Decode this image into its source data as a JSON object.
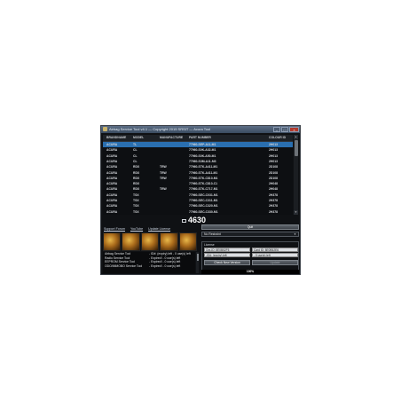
{
  "window": {
    "title": "Airbag Service Tool v4.1 — Copyright 2015 SRSIT — Acura Tool"
  },
  "table": {
    "columns": [
      "BRANDNAME",
      "MODEL",
      "MANUFACTURE",
      "PART NUMBER",
      "COLOUR ID"
    ],
    "rows": [
      [
        "ACURA",
        "TL",
        "",
        "77960-SEP-A11-M1",
        "2H013"
      ],
      [
        "ACURA",
        "CL",
        "",
        "77960-S0K-A32-M1",
        "2H013"
      ],
      [
        "ACURA",
        "CL",
        "",
        "77960-S0K-A50-M1",
        "2H013"
      ],
      [
        "ACURA",
        "CL",
        "",
        "77960-S3M-A11-M3",
        "2H013"
      ],
      [
        "ACURA",
        "RDX",
        "TRW",
        "77960-STK-A411-M1",
        "2D108"
      ],
      [
        "ACURA",
        "RDX",
        "TRW",
        "77960-STK-A411-M1",
        "2D108"
      ],
      [
        "ACURA",
        "RDX",
        "TRW",
        "77960-STK-C810-M1",
        "2D108"
      ],
      [
        "ACURA",
        "RDX",
        "",
        "77960-STK-C810-C1",
        "2H048"
      ],
      [
        "ACURA",
        "RDX",
        "TRW",
        "77960-STK-C717-M1",
        "2H048"
      ],
      [
        "ACURA",
        "TSX",
        "",
        "77960-SEC-C031-M1",
        "2H378"
      ],
      [
        "ACURA",
        "TSX",
        "",
        "77960-SEC-C311-M1",
        "2H378"
      ],
      [
        "ACURA",
        "TSX",
        "",
        "77960-SEC-C320-M1",
        "2H378"
      ],
      [
        "ACURA",
        "TSX",
        "",
        "77960-SEC-C330-M1",
        "2H378"
      ]
    ]
  },
  "counter": {
    "value": "4630"
  },
  "links": [
    "Support Forum",
    "YouTube",
    "Update License"
  ],
  "tools": [
    {
      "name": "Airbag Service Tool",
      "version": "- ID#: (expiry) left - 0 use(s) left"
    },
    {
      "name": "Radio Service Tool",
      "version": "- Expired!       - 0 use(s) left"
    },
    {
      "name": "EEPROM Service Tool",
      "version": "- Expired!       - 0 use(s) left"
    },
    {
      "name": "ODO/IMMOBO Service Tool",
      "version": "- Expired!       - 0 use(s) left"
    }
  ],
  "right": {
    "button_top": "Quit",
    "select_value": "No Restraint",
    "group_label": "License",
    "field1": "Ora-ID: 8E0B52F5",
    "field2": "Card ID: 8E0B52E6",
    "field3": "-ID#: (expiry) left",
    "field4": "- 0 use(s) left",
    "check_btn": "Check New Version",
    "update_btn": "Update",
    "status": "100%"
  }
}
